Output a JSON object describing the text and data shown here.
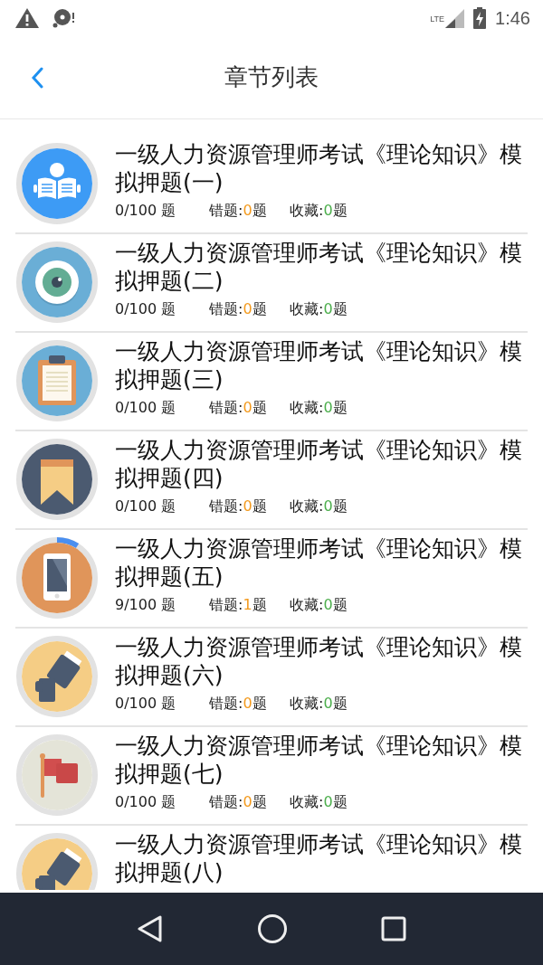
{
  "status_bar": {
    "network": "LTE",
    "time": "1:46"
  },
  "header": {
    "title": "章节列表"
  },
  "chapters": [
    {
      "kind": "book",
      "color": "#3d9bf5",
      "title": "一级人力资源管理师考试《理论知识》模拟押题(一)",
      "progress": "0/100 题",
      "wrong": {
        "label": "错题:",
        "count": "0",
        "unit": "题"
      },
      "favorites": {
        "label": "收藏:",
        "count": "0",
        "unit": "题"
      }
    },
    {
      "kind": "eye",
      "color": "#6aaed6",
      "title": "一级人力资源管理师考试《理论知识》模拟押题(二)",
      "progress": "0/100 题",
      "wrong": {
        "label": "错题:",
        "count": "0",
        "unit": "题"
      },
      "favorites": {
        "label": "收藏:",
        "count": "0",
        "unit": "题"
      }
    },
    {
      "kind": "clipboard",
      "color": "#6aaed6",
      "title": "一级人力资源管理师考试《理论知识》模拟押题(三)",
      "progress": "0/100 题",
      "wrong": {
        "label": "错题:",
        "count": "0",
        "unit": "题"
      },
      "favorites": {
        "label": "收藏:",
        "count": "0",
        "unit": "题"
      }
    },
    {
      "kind": "bookmark",
      "color": "#4b5a70",
      "title": "一级人力资源管理师考试《理论知识》模拟押题(四)",
      "progress": "0/100 题",
      "wrong": {
        "label": "错题:",
        "count": "0",
        "unit": "题"
      },
      "favorites": {
        "label": "收藏:",
        "count": "0",
        "unit": "题"
      }
    },
    {
      "kind": "phone",
      "color": "#e0955a",
      "level": 0.09,
      "title": "一级人力资源管理师考试《理论知识》模拟押题(五)",
      "progress": "9/100 题",
      "wrong": {
        "label": "错题:",
        "count": "1",
        "unit": "题"
      },
      "favorites": {
        "label": "收藏:",
        "count": "0",
        "unit": "题"
      }
    },
    {
      "kind": "usb",
      "color": "#f5cd85",
      "title": "一级人力资源管理师考试《理论知识》模拟押题(六)",
      "progress": "0/100 题",
      "wrong": {
        "label": "错题:",
        "count": "0",
        "unit": "题"
      },
      "favorites": {
        "label": "收藏:",
        "count": "0",
        "unit": "题"
      }
    },
    {
      "kind": "flag",
      "color": "#e4e4d8",
      "title": "一级人力资源管理师考试《理论知识》模拟押题(七)",
      "progress": "0/100 题",
      "wrong": {
        "label": "错题:",
        "count": "0",
        "unit": "题"
      },
      "favorites": {
        "label": "收藏:",
        "count": "0",
        "unit": "题"
      }
    },
    {
      "kind": "usb",
      "color": "#f5cd85",
      "title": "一级人力资源管理师考试《理论知识》模拟押题(八)"
    }
  ]
}
